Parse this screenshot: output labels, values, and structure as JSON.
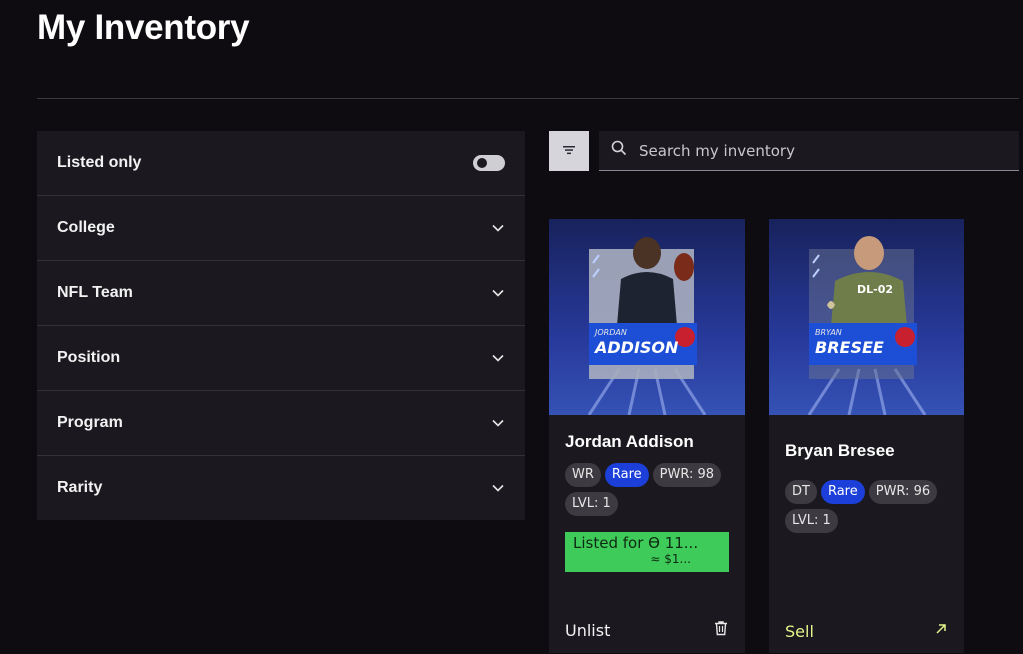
{
  "page": {
    "title": "My Inventory"
  },
  "filters": {
    "listed_only": {
      "label": "Listed only",
      "enabled": false
    },
    "items": [
      {
        "label": "College"
      },
      {
        "label": "NFL Team"
      },
      {
        "label": "Position"
      },
      {
        "label": "Program"
      },
      {
        "label": "Rarity"
      }
    ]
  },
  "toolbar": {
    "filter_icon": "filter-lines-icon",
    "search_placeholder": "Search my inventory"
  },
  "cards": [
    {
      "name": "Jordan Addison",
      "art_first_name": "JORDAN",
      "art_last_name": "ADDISON",
      "chips": [
        "WR",
        "Rare",
        "PWR: 98",
        "LVL: 1"
      ],
      "listing": {
        "line1": "Listed for ϴ 11...",
        "line2": "≈ $1..."
      },
      "action": {
        "label": "Unlist",
        "icon": "trash-icon"
      }
    },
    {
      "name": "Bryan Bresee",
      "art_first_name": "BRYAN",
      "art_last_name": "BRESEE",
      "art_jersey": "DL-02",
      "chips": [
        "DT",
        "Rare",
        "PWR: 96",
        "LVL: 1"
      ],
      "action": {
        "label": "Sell",
        "icon": "arrow-up-right-icon"
      }
    }
  ],
  "colors": {
    "background": "#0e0c11",
    "panel": "#1b191f",
    "rare_chip": "#1b3fd8",
    "listed_banner": "#3ecb5a",
    "sell_accent": "#e6f38a"
  }
}
